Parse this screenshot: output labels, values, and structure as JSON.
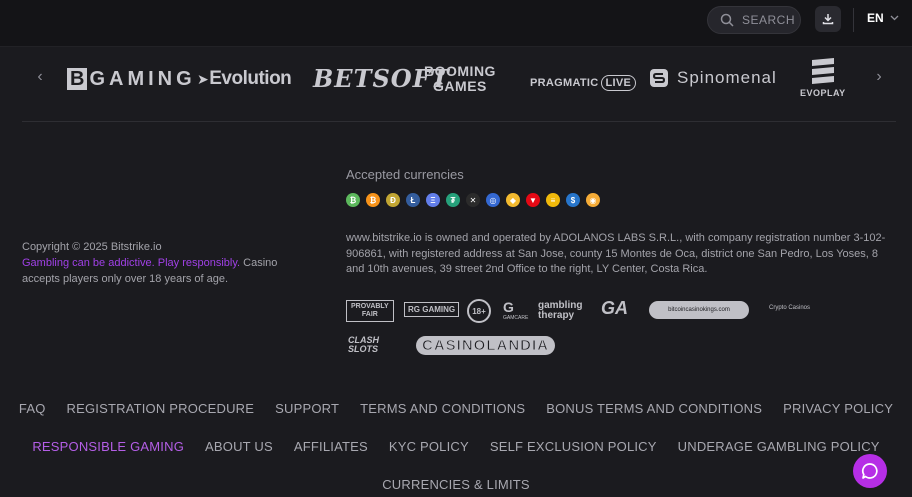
{
  "header": {
    "search_placeholder": "SEARCH",
    "language": "EN",
    "icons": [
      "search-icon",
      "download-icon",
      "chevron-down-icon"
    ]
  },
  "providers": {
    "bgaming_b": "B",
    "bgaming": "GAMING",
    "evolution": "Evolution",
    "betsoft": "BETSOFT",
    "booming_line1": "BOOMING",
    "booming_line2": "GAMES",
    "pragmatic": "PRAGMATIC",
    "pragmatic_live": "LIVE",
    "spinomenal": "Spinomenal",
    "evoplay": "EVOPLAY",
    "prev_arrow": "‹",
    "next_arrow": "›"
  },
  "currencies": {
    "title": "Accepted currencies",
    "coins": [
      {
        "sym": "₿",
        "color": "#5cb85c"
      },
      {
        "sym": "₿",
        "color": "#f7931a"
      },
      {
        "sym": "Ð",
        "color": "#c2a633"
      },
      {
        "sym": "Ł",
        "color": "#345d9d"
      },
      {
        "sym": "Ξ",
        "color": "#627eea"
      },
      {
        "sym": "₮",
        "color": "#26a17b"
      },
      {
        "sym": "✕",
        "color": "#2b2b2b"
      },
      {
        "sym": "◎",
        "color": "#3468d1"
      },
      {
        "sym": "◆",
        "color": "#f3ba2f"
      },
      {
        "sym": "▼",
        "color": "#e50915"
      },
      {
        "sym": "≡",
        "color": "#f0b90b"
      },
      {
        "sym": "$",
        "color": "#2775ca"
      },
      {
        "sym": "◉",
        "color": "#f5ac37"
      }
    ]
  },
  "legal": {
    "copyright": "Copyright © 2025 Bitstrike.io",
    "warning": "Gambling can be addictive. Play responsibly.",
    "age_text": " Casino accepts players only over 18 years of age.",
    "company": "www.bitstrike.io is owned and operated by ADOLANOS LABS S.R.L., with company registration number 3-102-906861, with registered address at San Jose, county 15 Montes de Oca, district one San Pedro, Los Yoses, 8 and 10th avenues, 39 street 2nd Office to the right, LY Center, Costa Rica."
  },
  "badges": {
    "provably_line1": "PROVABLY",
    "provably_line2": "FAIR",
    "rg": "RG GAMING",
    "age": "18+",
    "gamcare": "G",
    "gamcare_small": "GAMCARE",
    "gambling_therapy_line1": "gambling",
    "gambling_therapy_line2": "therapy",
    "ga": "GA",
    "bitcoin_casino_kings": "bitcoincasinokings.com",
    "crypto_casinos": "Crypto Casinos",
    "clash_line1": "CLASH",
    "clash_line2": "SLOTS",
    "casinolandia": "CASINOLANDIA"
  },
  "footer": {
    "row1": [
      "FAQ",
      "REGISTRATION PROCEDURE",
      "SUPPORT",
      "TERMS AND CONDITIONS",
      "BONUS TERMS AND CONDITIONS",
      "PRIVACY POLICY"
    ],
    "row2": [
      "RESPONSIBLE GAMING",
      "ABOUT US",
      "AFFILIATES",
      "KYC POLICY",
      "SELF EXCLUSION POLICY",
      "UNDERAGE GAMBLING POLICY"
    ],
    "row3": [
      "CURRENCIES & LIMITS"
    ]
  },
  "colors": {
    "background": "#1b1b1f",
    "accent": "#b62ee6",
    "responsible_link": "#b45ee6"
  }
}
